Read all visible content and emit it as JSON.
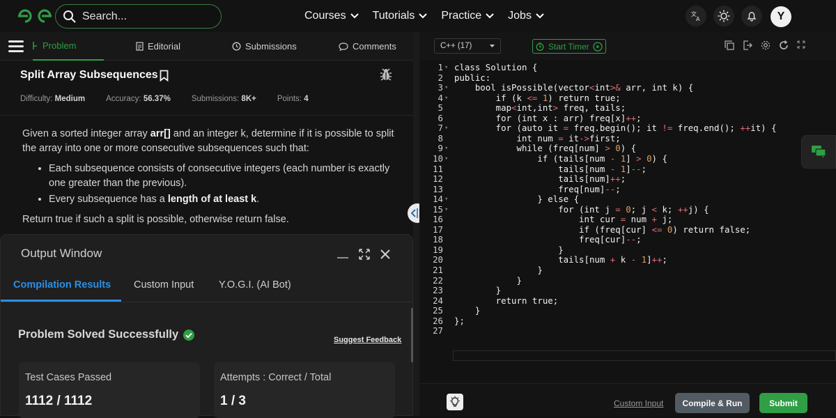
{
  "header": {
    "search_placeholder": "Search...",
    "nav": [
      {
        "label": "Courses"
      },
      {
        "label": "Tutorials"
      },
      {
        "label": "Practice"
      },
      {
        "label": "Jobs"
      }
    ],
    "avatar_initial": "Y",
    "brand_color": "#2f9e44"
  },
  "left_tabs": {
    "problem": "Problem",
    "editorial": "Editorial",
    "submissions": "Submissions",
    "comments": "Comments"
  },
  "problem": {
    "title": "Split Array Subsequences",
    "difficulty_label": "Difficulty:",
    "difficulty": "Medium",
    "accuracy_label": "Accuracy:",
    "accuracy": "56.37%",
    "submissions_label": "Submissions:",
    "submissions": "8K+",
    "points_label": "Points:",
    "points": "4",
    "para1_a": "Given a sorted integer array ",
    "para1_b": "arr[]",
    "para1_c": " and an integer k, determine if it is possible to split the array into one or more consecutive subsequences such that:",
    "bullet1": "Each subsequence consists of consecutive integers (each number is exactly one greater than the previous).",
    "bullet2_a": "Every subsequence has a ",
    "bullet2_b": "length of at least k",
    "bullet2_c": ".",
    "para2": "Return true if such a split is possible, otherwise return false."
  },
  "output": {
    "title": "Output Window",
    "tabs": [
      "Compilation Results",
      "Custom Input",
      "Y.O.G.I. (AI Bot)"
    ],
    "status": "Problem Solved Successfully",
    "feedback": "Suggest Feedback",
    "card1_label": "Test Cases Passed",
    "card1_value": "1112 / 1112",
    "card2_label": "Attempts : Correct / Total",
    "card2_value": "1 / 3"
  },
  "editor": {
    "language": "C++ (17)",
    "timer": "Start Timer",
    "custom_input": "Custom Input",
    "compile": "Compile & Run",
    "submit": "Submit",
    "lines": [
      "class Solution {",
      "public:",
      "    bool isPossible(vector<int>& arr, int k) {",
      "        if (k <= 1) return true;",
      "        map<int,int> freq, tails;",
      "        for (int x : arr) freq[x]++;",
      "        for (auto it = freq.begin(); it != freq.end(); ++it) {",
      "            int num = it->first;",
      "            while (freq[num] > 0) {",
      "                if (tails[num - 1] > 0) {",
      "                    tails[num - 1]--;",
      "                    tails[num]++;",
      "                    freq[num]--;",
      "                } else {",
      "                    for (int j = 0; j < k; ++j) {",
      "                        int cur = num + j;",
      "                        if (freq[cur] <= 0) return false;",
      "                        freq[cur]--;",
      "                    }",
      "                    tails[num + k - 1]++;",
      "                }",
      "            }",
      "        }",
      "        return true;",
      "    }",
      "};",
      ""
    ],
    "fold_lines": [
      1,
      3,
      4,
      7,
      9,
      10,
      14,
      15
    ]
  }
}
